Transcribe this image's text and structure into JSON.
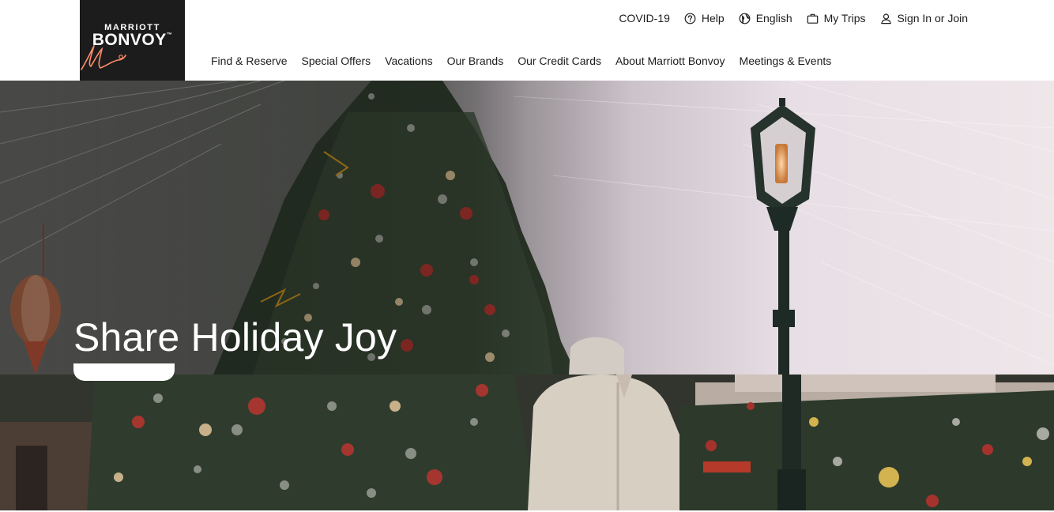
{
  "brand": {
    "top": "MARRIOTT",
    "main": "BONV",
    "main_o": "O",
    "main_end": "Y",
    "tm": "™"
  },
  "utility_nav": {
    "covid": "COVID-19",
    "help": "Help",
    "language": "English",
    "trips": "My Trips",
    "signin": "Sign In or Join"
  },
  "main_nav": [
    "Find & Reserve",
    "Special Offers",
    "Vacations",
    "Our Brands",
    "Our Credit Cards",
    "About Marriott Bonvoy",
    "Meetings & Events"
  ],
  "hero": {
    "title": "Share Holiday Joy",
    "cta_label": ""
  },
  "colors": {
    "logo_bg": "#1c1c1c",
    "accent": "#ff8d6b",
    "text": "#1c1c1c"
  },
  "icons": {
    "help": "question-circle-icon",
    "language": "globe-icon",
    "trips": "suitcase-icon",
    "signin": "person-icon"
  }
}
